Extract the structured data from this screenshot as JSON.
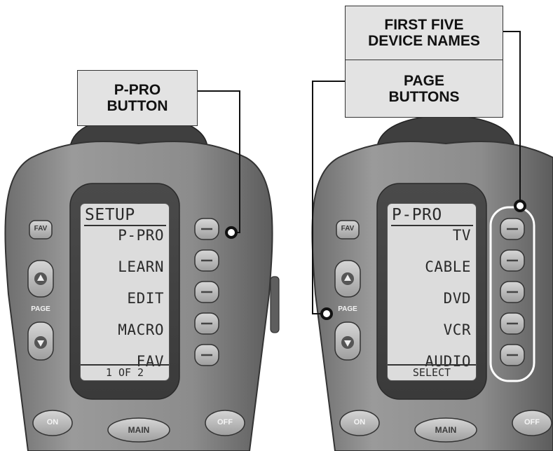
{
  "callouts": {
    "pro_button": "P-PRO\nBUTTON",
    "device_names": "FIRST FIVE\nDEVICE NAMES",
    "page_buttons": "PAGE\nBUTTONS"
  },
  "left_remote": {
    "screen_title": "SETUP",
    "items": [
      "P-PRO",
      "LEARN",
      "EDIT",
      "MACRO",
      "FAV"
    ],
    "footer": "1 OF 2"
  },
  "right_remote": {
    "screen_title": "P-PRO",
    "items": [
      "TV",
      "CABLE",
      "DVD",
      "VCR",
      "AUDIO"
    ],
    "footer": "SELECT"
  },
  "hardware_labels": {
    "fav": "FAV",
    "page": "PAGE",
    "on": "ON",
    "main": "MAIN",
    "off": "OFF"
  },
  "colors": {
    "body": "#8a8a8a",
    "body_dark": "#5a5a5a",
    "screen": "#dcdcdc",
    "callout_fill": "#e3e3e3"
  }
}
